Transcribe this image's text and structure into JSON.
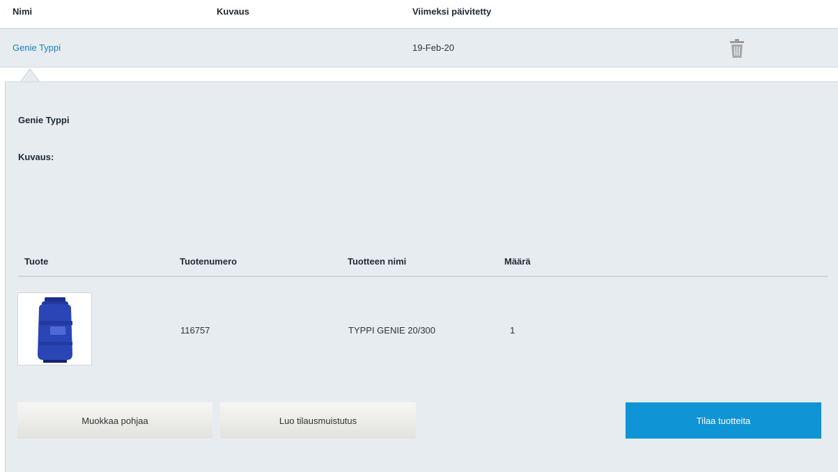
{
  "table_header": {
    "name": "Nimi",
    "description": "Kuvaus",
    "updated": "Viimeksi päivitetty"
  },
  "template_row": {
    "name": "Genie Typpi",
    "updated": "19-Feb-20",
    "delete_icon": "trash-icon"
  },
  "details": {
    "title": "Genie Typpi",
    "description_label": "Kuvaus:",
    "products_header": {
      "product": "Tuote",
      "product_number": "Tuotenumero",
      "product_name": "Tuotteen nimi",
      "quantity": "Määrä"
    },
    "products": [
      {
        "image": "gas-cylinder-image",
        "product_number": "116757",
        "product_name": "TYPPI GENIE 20/300",
        "quantity": "1"
      }
    ],
    "buttons": {
      "edit": "Muokkaa pohjaa",
      "reminder": "Luo tilausmuistutus",
      "order": "Tilaa tuotteita"
    }
  },
  "colors": {
    "link": "#1a7fbf",
    "panel_bg": "#e6ecef",
    "primary_button": "#0f95d5"
  }
}
